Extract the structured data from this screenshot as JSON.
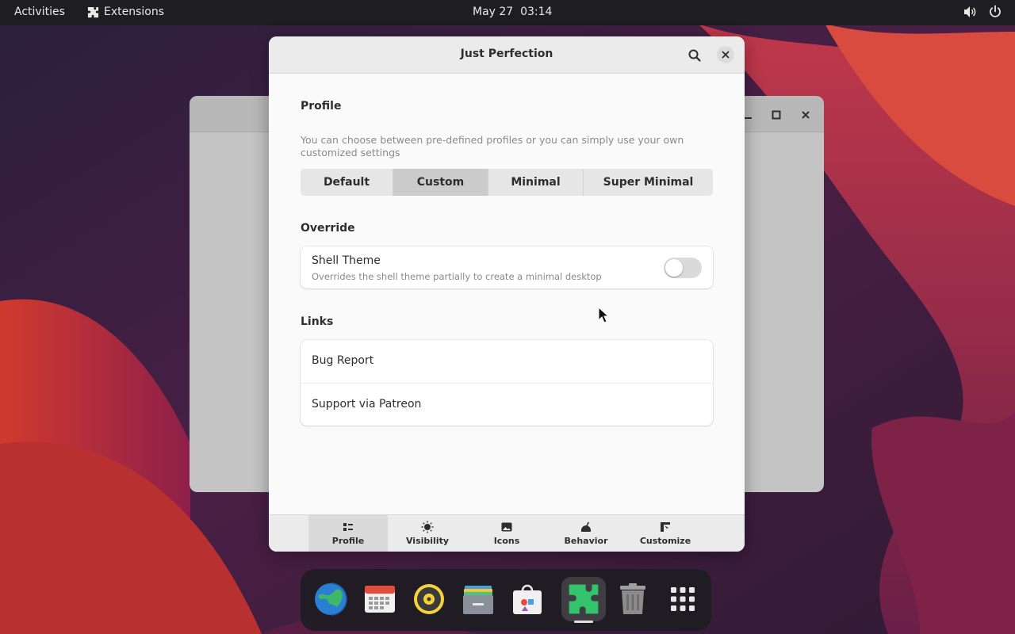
{
  "topbar": {
    "activities": "Activities",
    "extensions": "Extensions",
    "clock": "May 27  03:14"
  },
  "dialog": {
    "title": "Just Perfection",
    "profile": {
      "title": "Profile",
      "description": "You can choose between pre-defined profiles or you can simply use your own customized settings",
      "options": [
        "Default",
        "Custom",
        "Minimal",
        "Super Minimal"
      ],
      "selected": "Custom"
    },
    "override": {
      "title": "Override",
      "shell_theme": {
        "title": "Shell Theme",
        "subtitle": "Overrides the shell theme partially to create a minimal desktop",
        "enabled": false
      }
    },
    "links": {
      "title": "Links",
      "items": [
        "Bug Report",
        "Support via Patreon"
      ]
    },
    "tabs": [
      {
        "label": "Profile",
        "icon": "profile-icon"
      },
      {
        "label": "Visibility",
        "icon": "sun-icon"
      },
      {
        "label": "Icons",
        "icon": "image-icon"
      },
      {
        "label": "Behavior",
        "icon": "behavior-icon"
      },
      {
        "label": "Customize",
        "icon": "customize-icon"
      }
    ],
    "active_tab": "Profile"
  },
  "dock": {
    "apps": [
      "browser-icon",
      "calendar-icon",
      "music-icon",
      "files-icon",
      "software-icon",
      "extensions-icon",
      "trash-icon",
      "app-grid-icon"
    ],
    "running": "extensions-icon"
  },
  "colors": {
    "topbar": "#1e1e22",
    "dialog_bg": "#fafafa",
    "segment_active": "#cbcbcb",
    "extensions_green": "#33c36c"
  }
}
